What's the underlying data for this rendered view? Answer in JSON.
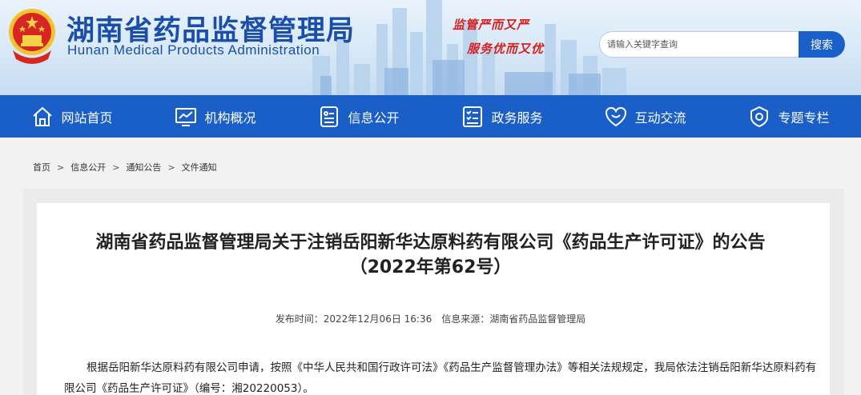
{
  "header": {
    "title": "湖南省药品监督管理局",
    "subtitle": "Hunan Medical Products Administration",
    "slogan_line1": "监管严而又严",
    "slogan_line2": "服务优而又优"
  },
  "search": {
    "placeholder": "请输入关键字查询",
    "button_label": "搜索"
  },
  "nav": {
    "items": [
      {
        "label": "网站首页",
        "icon": "home-icon"
      },
      {
        "label": "机构概况",
        "icon": "monitor-chart-icon"
      },
      {
        "label": "信息公开",
        "icon": "document-list-icon"
      },
      {
        "label": "政务服务",
        "icon": "checklist-icon"
      },
      {
        "label": "互动交流",
        "icon": "heart-chat-icon"
      },
      {
        "label": "专题专栏",
        "icon": "badge-gear-icon"
      }
    ]
  },
  "breadcrumb": [
    "首页",
    "信息公开",
    "通知公告",
    "文件通知"
  ],
  "article": {
    "title_line1": "湖南省药品监督管理局关于注销岳阳新华达原料药有限公司《药品生产许可证》的公告",
    "title_line2": "（2022年第62号）",
    "publish_time": "发布时间：2022年12月06日 16:36",
    "source": "信息来源：湖南省药品监督管理局",
    "body": "根据岳阳新华达原料药有限公司申请，按照《中华人民共和国行政许可法》《药品生产监督管理办法》等相关法规规定，我局依法注销岳阳新华达原料药有限公司《药品生产许可证》（编号：湘20220053）。"
  },
  "colors": {
    "nav_bg": "#1a5fc8",
    "title_blue": "#1a4ea8",
    "slogan_red": "#d81e1e"
  }
}
